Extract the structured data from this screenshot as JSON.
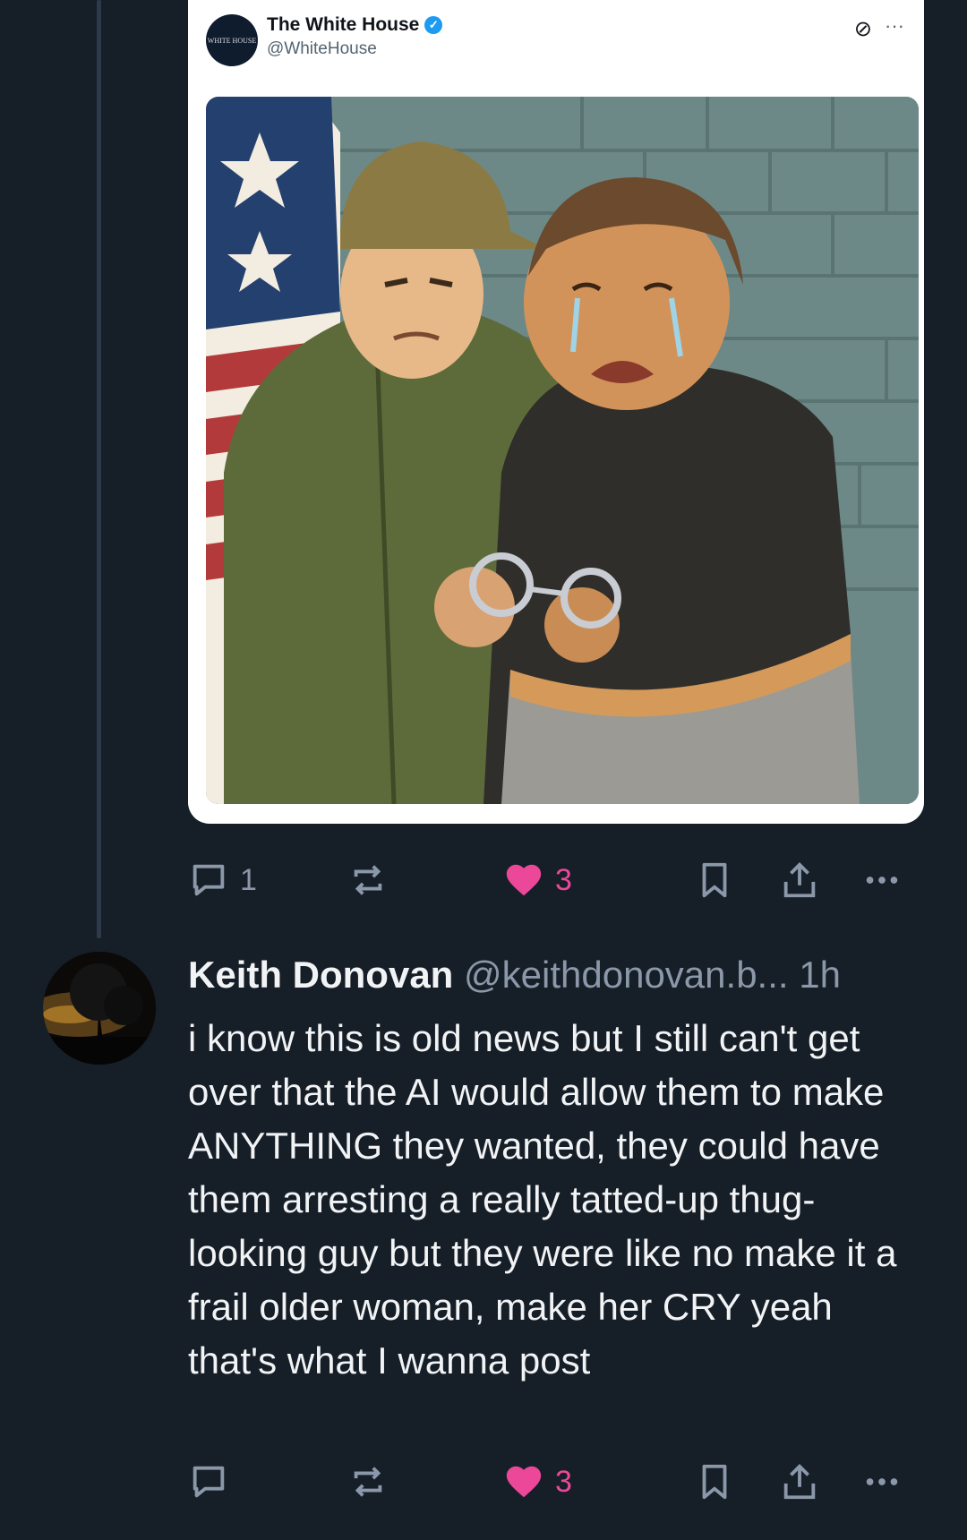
{
  "quoted_post": {
    "author_name": "The White House",
    "author_handle": "@WhiteHouse",
    "avatar_text": "WHITE HOUSE",
    "verified_icon": "verified-badge-icon",
    "grok_icon": "grok-icon",
    "more_icon": "more-icon",
    "image_alt": "Cartoon of a uniformed officer handcuffing a crying woman in front of an American flag"
  },
  "parent_actions": {
    "reply_count": "1",
    "like_count": "3",
    "like_color": "#ec4899"
  },
  "reply": {
    "author_name": "Keith Donovan",
    "author_handle": "@keithdonovan.b...",
    "time": "1h",
    "text": "i know this is old news but I still can't get over that the AI would allow them to make ANYTHING they wanted, they could have them arresting a really tatted-up thug-looking guy but they were like no make it a frail older woman, make her CRY yeah that's what I wanna post"
  },
  "reply_actions": {
    "like_count": "3",
    "like_color": "#ec4899"
  },
  "colors": {
    "background": "#161e27",
    "thread_line": "#2c3a4b",
    "muted_text": "#8b98a9"
  }
}
